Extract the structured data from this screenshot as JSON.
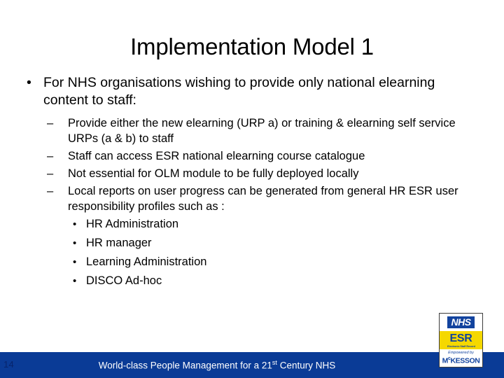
{
  "slide": {
    "title": "Implementation Model 1",
    "bullets": [
      {
        "marker": "•",
        "text": "For NHS organisations wishing to provide only national elearning content to staff:"
      }
    ],
    "sub_bullets": [
      {
        "marker": "–",
        "text": "Provide either the new elearning (URP a) or training  & elearning self service URPs (a & b) to staff"
      },
      {
        "marker": "–",
        "text": "Staff can access ESR national elearning course catalogue"
      },
      {
        "marker": "–",
        "text": "Not essential for OLM module to be fully deployed locally"
      },
      {
        "marker": "–",
        "text": "Local reports on user progress can be generated from general HR ESR user responsibility profiles such as :"
      }
    ],
    "sub_sub_bullets": [
      {
        "marker": "•",
        "text": "HR Administration"
      },
      {
        "marker": "•",
        "text": "HR manager"
      },
      {
        "marker": "•",
        "text": "Learning Administration"
      },
      {
        "marker": "•",
        "text": "DISCO Ad-hoc"
      }
    ]
  },
  "footer": {
    "page_number": "14",
    "text_before": "World-class People Management for a 21",
    "superscript": "st",
    "text_after": " Century NHS",
    "bar_color": "#0A3B96"
  },
  "logo": {
    "nhs": "NHS",
    "esr": "ESR",
    "esr_subtitle": "Electronic Staff Record",
    "mckesson_prefix": "Empowered by",
    "mckesson_main": "M",
    "mckesson_sup": "c",
    "mckesson_rest": "KESSON",
    "nhs_blue": "#12439e",
    "esr_yellow": "#f5d800"
  }
}
